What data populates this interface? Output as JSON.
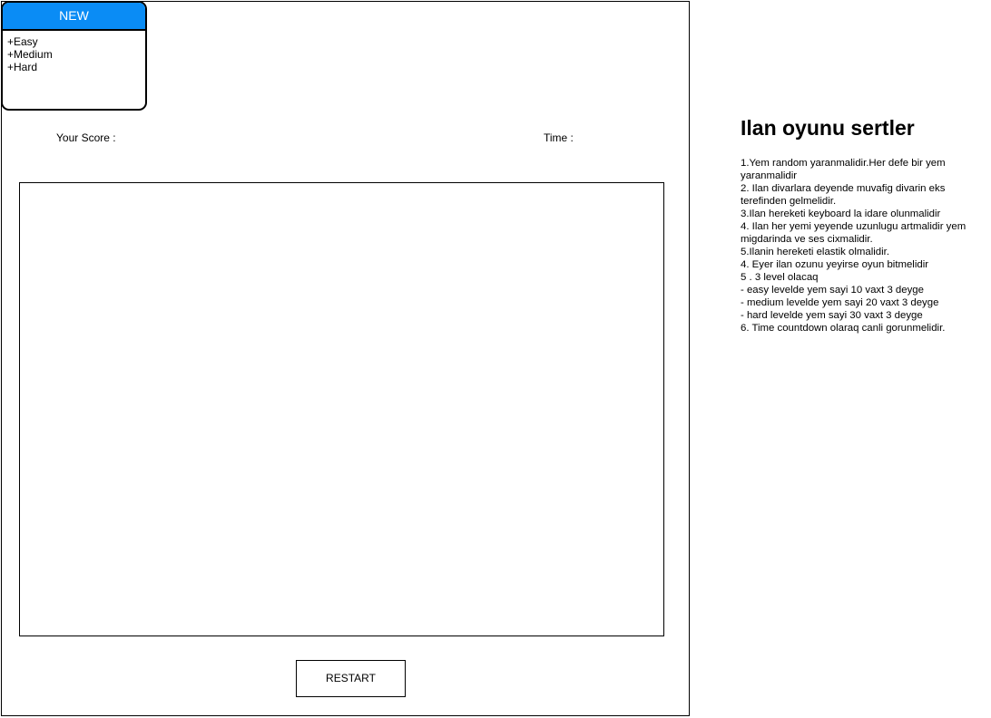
{
  "menu": {
    "header": "NEW",
    "items": [
      "+Easy",
      "+Medium",
      "+Hard"
    ]
  },
  "hud": {
    "score_label": "Your Score :",
    "time_label": "Time :"
  },
  "controls": {
    "restart_label": "RESTART"
  },
  "rules": {
    "title": "Ilan oyunu sertler",
    "items": [
      "1.Yem random yaranmalidir.Her defe bir yem yaranmalidir",
      "2. Ilan divarlara deyende muvafig divarin eks terefinden gelmelidir.",
      "3.Ilan hereketi keyboard la idare olunmalidir",
      "4. Ilan her yemi yeyende uzunlugu artmalidir yem migdarinda ve ses cixmalidir.",
      "5.Ilanin hereketi elastik olmalidir.",
      "4. Eyer ilan ozunu yeyirse oyun bitmelidir",
      "5 . 3 level olacaq",
      "- easy levelde yem sayi 10 vaxt 3 deyge",
      "- medium levelde yem sayi 20 vaxt 3 deyge",
      "- hard levelde yem sayi 30 vaxt 3 deyge",
      "6. Time countdown olaraq canli gorunmelidir."
    ]
  },
  "colors": {
    "menu_header_bg": "#0a8cf5",
    "menu_header_text": "#ffffff",
    "border": "#000000"
  }
}
